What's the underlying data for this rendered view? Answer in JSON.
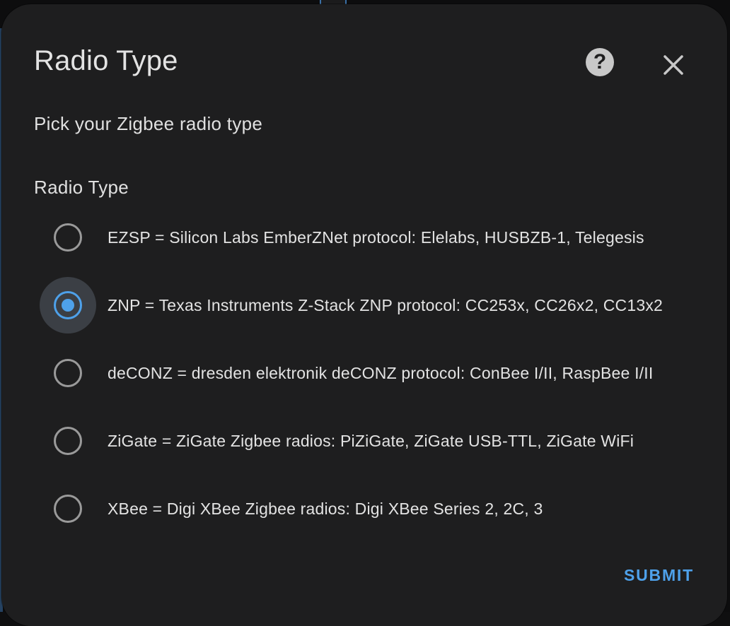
{
  "dialog": {
    "title": "Radio Type",
    "description": "Pick your Zigbee radio type",
    "help_icon_glyph": "?",
    "help_icon": "help-circle-icon",
    "close_icon": "close-icon"
  },
  "field": {
    "label": "Radio Type",
    "selected_index": 1,
    "options": [
      {
        "label": "EZSP = Silicon Labs EmberZNet protocol: Elelabs, HUSBZB-1, Telegesis"
      },
      {
        "label": "ZNP = Texas Instruments Z-Stack ZNP protocol: CC253x, CC26x2, CC13x2"
      },
      {
        "label": "deCONZ = dresden elektronik deCONZ protocol: ConBee I/II, RaspBee I/II"
      },
      {
        "label": "ZiGate = ZiGate Zigbee radios: PiZiGate, ZiGate USB-TTL, ZiGate WiFi"
      },
      {
        "label": "XBee = Digi XBee Zigbee radios: Digi XBee Series 2, 2C, 3"
      }
    ]
  },
  "actions": {
    "submit_label": "SUBMIT"
  },
  "colors": {
    "accent": "#4ea1ea",
    "dialog_bg": "#1e1e1f",
    "text": "#e3e3e3",
    "radio_unselected": "#9a9a9a"
  }
}
